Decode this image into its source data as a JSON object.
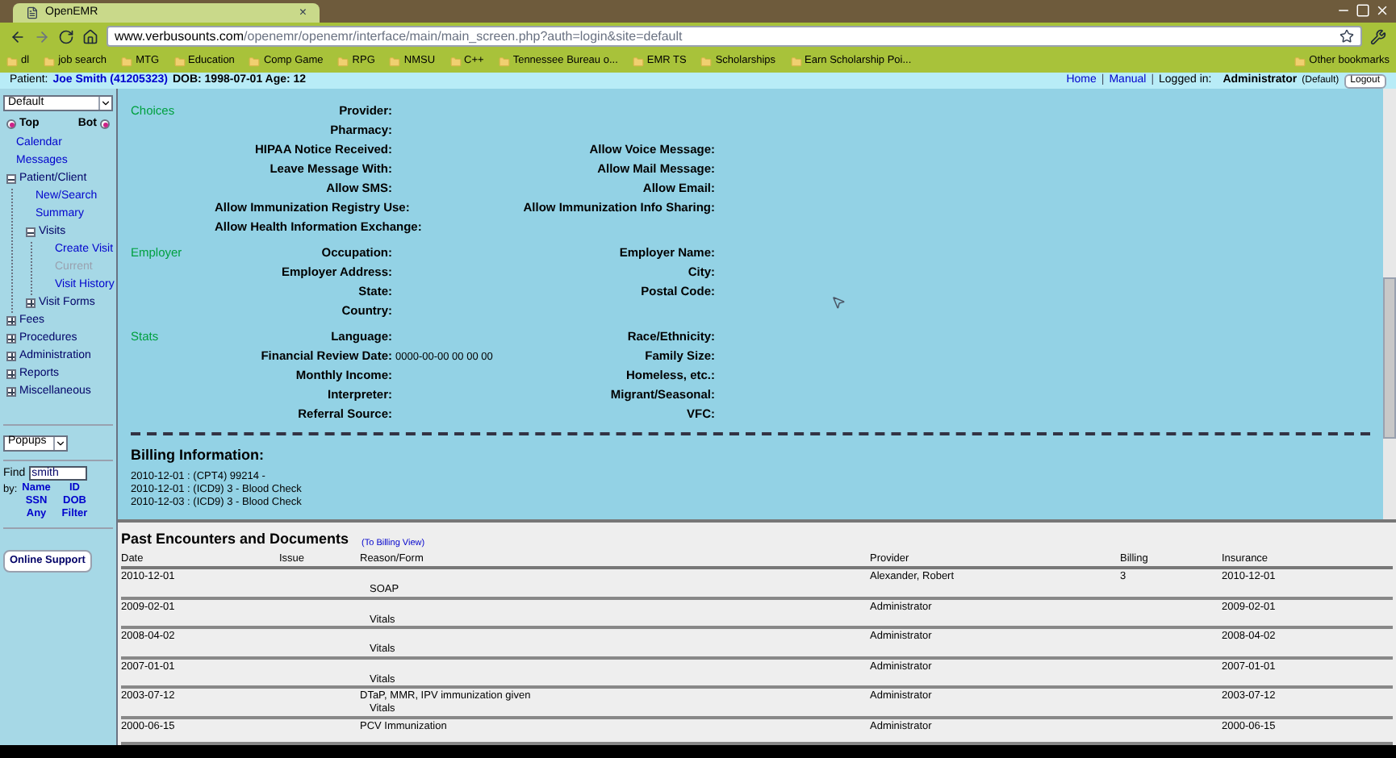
{
  "browser": {
    "tab": {
      "title": "OpenEMR",
      "close": "×"
    },
    "url": {
      "domain": "www.verbusounts.com",
      "path": "/openemr/openemr/interface/main/main_screen.php?auth=login&site=default"
    },
    "bookmarks": [
      {
        "label": "dl"
      },
      {
        "label": "job search"
      },
      {
        "label": "MTG"
      },
      {
        "label": "Education"
      },
      {
        "label": "Comp Game"
      },
      {
        "label": "RPG"
      },
      {
        "label": "NMSU"
      },
      {
        "label": "C++"
      },
      {
        "label": "Tennessee Bureau o..."
      },
      {
        "label": "EMR TS"
      },
      {
        "label": "Scholarships"
      },
      {
        "label": "Earn Scholarship Poi..."
      }
    ],
    "other_bookmarks": "Other bookmarks"
  },
  "patient_bar": {
    "label": "Patient:",
    "patient": "Joe Smith (41205323)",
    "dob": "DOB: 1998-07-01 Age: 12",
    "links": [
      "Home",
      "Manual"
    ],
    "separator": "|",
    "logged_in": "Logged in:",
    "user": "Administrator",
    "site": "(Default)",
    "logout": "Logout"
  },
  "sidebar": {
    "view_select": "Default",
    "frames": [
      {
        "label": "Top",
        "checked": true
      },
      {
        "label": "Bot",
        "checked": true
      }
    ],
    "tree": [
      {
        "label": "Calendar",
        "kind": "link",
        "disabled": false
      },
      {
        "label": "Messages",
        "kind": "link",
        "disabled": false
      },
      {
        "label": "Patient/Client",
        "kind": "folder",
        "expanded": true,
        "children": [
          {
            "label": "New/Search",
            "kind": "link",
            "disabled": false
          },
          {
            "label": "Summary",
            "kind": "link",
            "disabled": false
          },
          {
            "label": "Visits",
            "kind": "folder",
            "expanded": true,
            "children": [
              {
                "label": "Create Visit",
                "kind": "link",
                "disabled": false
              },
              {
                "label": "Current",
                "kind": "link",
                "disabled": true
              },
              {
                "label": "Visit History",
                "kind": "link",
                "disabled": false
              }
            ]
          },
          {
            "label": "Visit Forms",
            "kind": "folder",
            "expanded": false
          }
        ]
      },
      {
        "label": "Fees",
        "kind": "folder",
        "expanded": false
      },
      {
        "label": "Procedures",
        "kind": "folder",
        "expanded": false
      },
      {
        "label": "Administration",
        "kind": "folder",
        "expanded": false
      },
      {
        "label": "Reports",
        "kind": "folder",
        "expanded": false
      },
      {
        "label": "Miscellaneous",
        "kind": "folder",
        "expanded": false
      }
    ],
    "popups_select": "Popups",
    "find_label": "Find",
    "find_value": "smith",
    "by_label": "by:",
    "by_links": [
      "Name",
      "ID",
      "SSN",
      "DOB",
      "Any",
      "Filter"
    ],
    "support_button": "Online Support"
  },
  "demographics": [
    {
      "title": "Choices",
      "rows": [
        {
          "left": "Provider:"
        },
        {
          "left": "Pharmacy:"
        },
        {
          "left": "HIPAA Notice Received:",
          "right": "Allow Voice Message:"
        },
        {
          "left": "Leave Message With:",
          "right": "Allow Mail Message:"
        },
        {
          "left": "Allow SMS:",
          "right": "Allow Email:"
        },
        {
          "left": "Allow Immunization Registry Use:",
          "right": "Allow Immunization Info Sharing:"
        },
        {
          "left": "Allow Health Information Exchange:"
        }
      ]
    },
    {
      "title": "Employer",
      "rows": [
        {
          "left": "Occupation:",
          "right": "Employer Name:"
        },
        {
          "left": "Employer Address:",
          "right": "City:"
        },
        {
          "left": "State:",
          "right": "Postal Code:"
        },
        {
          "left": "Country:"
        }
      ]
    },
    {
      "title": "Stats",
      "rows": [
        {
          "left": "Language:",
          "right": "Race/Ethnicity:"
        },
        {
          "left": "Financial Review Date:",
          "left_value": "0000-00-00 00 00 00",
          "right": "Family Size:"
        },
        {
          "left": "Monthly Income:",
          "right": "Homeless, etc.:"
        },
        {
          "left": "Interpreter:",
          "right": "Migrant/Seasonal:"
        },
        {
          "left": "Referral Source:",
          "right": "VFC:"
        }
      ]
    }
  ],
  "billing": {
    "title": "Billing Information:",
    "lines": [
      "2010-12-01 : (CPT4) 99214 -",
      "2010-12-01 : (ICD9) 3 - Blood Check",
      "2010-12-03 : (ICD9) 3 - Blood Check"
    ]
  },
  "encounters": {
    "title": "Past Encounters and Documents",
    "billing_link": "(To Billing View)",
    "columns": [
      "Date",
      "Issue",
      "Reason/Form",
      "Provider",
      "Billing",
      "Insurance"
    ],
    "rows": [
      {
        "date": "2010-12-01",
        "form": "SOAP",
        "provider": "Alexander, Robert",
        "billing": "3",
        "insurance": "2010-12-01"
      },
      {
        "date": "2009-02-01",
        "form": "Vitals",
        "provider": "Administrator",
        "insurance": "2009-02-01"
      },
      {
        "date": "2008-04-02",
        "form": "Vitals",
        "provider": "Administrator",
        "insurance": "2008-04-02"
      },
      {
        "date": "2007-01-01",
        "form": "Vitals",
        "provider": "Administrator",
        "insurance": "2007-01-01"
      },
      {
        "date": "2003-07-12",
        "reason": "DTaP, MMR, IPV immunization given",
        "form": "Vitals",
        "provider": "Administrator",
        "insurance": "2003-07-12"
      },
      {
        "date": "2000-06-15",
        "reason": "PCV Immunization",
        "provider": "Administrator",
        "insurance": "2000-06-15"
      }
    ]
  }
}
